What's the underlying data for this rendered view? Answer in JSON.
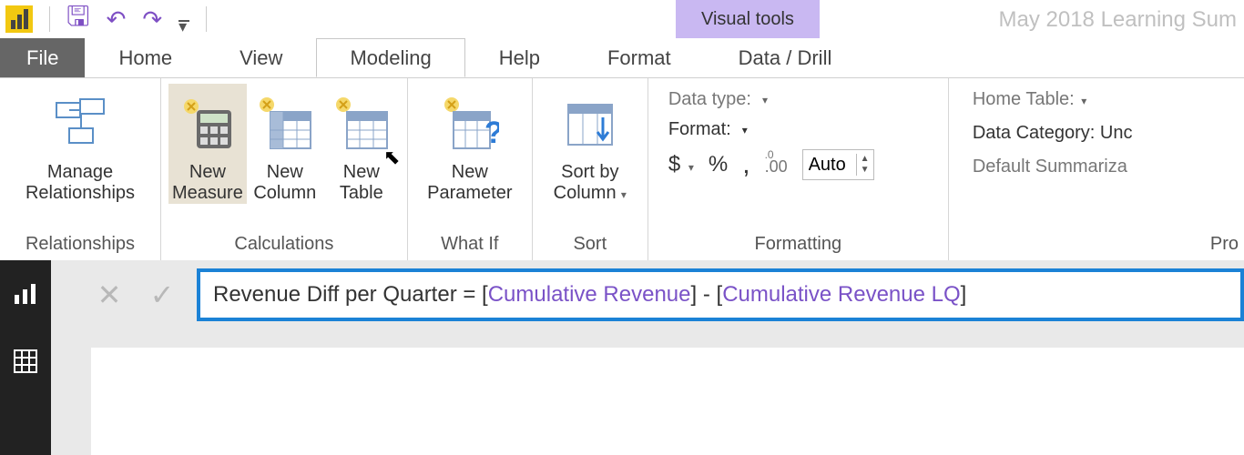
{
  "titlebar": {
    "contextual_tab": "Visual tools",
    "document_title": "May 2018 Learning Sum"
  },
  "tabs": {
    "file": "File",
    "home": "Home",
    "view": "View",
    "modeling": "Modeling",
    "help": "Help",
    "format": "Format",
    "data_drill": "Data / Drill"
  },
  "ribbon": {
    "relationships": {
      "manage": "Manage\nRelationships",
      "group": "Relationships"
    },
    "calculations": {
      "new_measure": "New\nMeasure",
      "new_column": "New\nColumn",
      "new_table": "New\nTable",
      "group": "Calculations"
    },
    "whatif": {
      "new_parameter": "New\nParameter",
      "group": "What If"
    },
    "sort": {
      "sort_by_column": "Sort by\nColumn",
      "group": "Sort"
    },
    "formatting": {
      "data_type_label": "Data type:",
      "format_label": "Format:",
      "currency_symbol": "$",
      "percent_symbol": "%",
      "thousands_symbol": ",",
      "decimal_icon": ".00",
      "decimal_value": "Auto",
      "group": "Formatting"
    },
    "properties": {
      "home_table_label": "Home Table:",
      "data_category_label": "Data Category: Unc",
      "default_summarization_label": "Default Summariza",
      "group": "Pro"
    }
  },
  "formula": {
    "prefix": "Revenue Diff per Quarter = [",
    "m1": "Cumulative Revenue",
    "mid": "] - [",
    "m2": "Cumulative Revenue LQ",
    "suffix": "]"
  }
}
